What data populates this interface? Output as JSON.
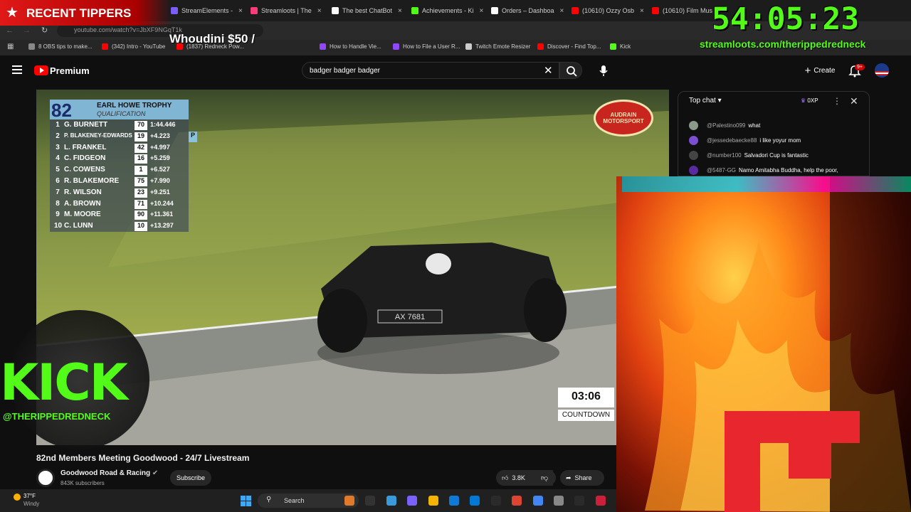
{
  "browser": {
    "tabs": [
      {
        "title": "StreamElements -",
        "color": "#7a5cff"
      },
      {
        "title": "Streamloots | The",
        "color": "#ff3c78"
      },
      {
        "title": "The best ChatBot",
        "color": "#ffffff"
      },
      {
        "title": "Achievements - Ki",
        "color": "#53fc18"
      },
      {
        "title": "Orders – Dashboa",
        "color": "#ffffff"
      },
      {
        "title": "(10610) Ozzy Osb",
        "color": "#ff0000"
      },
      {
        "title": "(10610) Film Mus",
        "color": "#ff0000"
      }
    ],
    "address": "youtube.com/watch?v=JbXF9NGqT1k",
    "bookmarks": [
      {
        "label": "8 OBS tips to make...",
        "color": "#888888"
      },
      {
        "label": "(342) Intro - YouTube",
        "color": "#ff0000"
      },
      {
        "label": "(1837) Redneck Pow...",
        "color": "#ff0000"
      },
      {
        "label": "How to Handle Vie...",
        "color": "#9146ff"
      },
      {
        "label": "How to File a User R...",
        "color": "#9146ff"
      },
      {
        "label": "Twitch Emote Resizer",
        "color": "#cccccc"
      },
      {
        "label": "Discover - Find Top...",
        "color": "#ff0000"
      },
      {
        "label": "Kick",
        "color": "#53fc18"
      }
    ]
  },
  "youtube": {
    "premium": "Premium",
    "search_value": "badger badger badger",
    "create_label": "Create",
    "bell_badge": "9+"
  },
  "video": {
    "leaderboard": {
      "number": "82",
      "title": "EARL HOWE TROPHY",
      "subtitle": "QUALIFICATION",
      "rows": [
        {
          "pos": "1",
          "name": "G. BURNETT",
          "car": "70",
          "gap": "1:44.446"
        },
        {
          "pos": "2",
          "name": "P. BLAKENEY-EDWARDS",
          "car": "19",
          "gap": "+4.223"
        },
        {
          "pos": "3",
          "name": "L. FRANKEL",
          "car": "42",
          "gap": "+4.997"
        },
        {
          "pos": "4",
          "name": "C. FIDGEON",
          "car": "16",
          "gap": "+5.259"
        },
        {
          "pos": "5",
          "name": "C. COWENS",
          "car": "1",
          "gap": "+6.527"
        },
        {
          "pos": "6",
          "name": "R. BLAKEMORE",
          "car": "75",
          "gap": "+7.990"
        },
        {
          "pos": "7",
          "name": "R. WILSON",
          "car": "23",
          "gap": "+9.251"
        },
        {
          "pos": "8",
          "name": "A. BROWN",
          "car": "71",
          "gap": "+10.244"
        },
        {
          "pos": "9",
          "name": "M. MOORE",
          "car": "90",
          "gap": "+11.361"
        },
        {
          "pos": "10",
          "name": "C. LUNN",
          "car": "10",
          "gap": "+13.297"
        }
      ],
      "pit_flag": "P"
    },
    "sponsor": "AUDRAIN MOTORSPORT",
    "plate": "AX 7681",
    "countdown_time": "03:06",
    "countdown_label": "COUNTDOWN",
    "title": "82nd Members Meeting Goodwood - 24/7 Livestream",
    "channel": "Goodwood Road & Racing",
    "subscribers": "843K subscribers",
    "subscribe_label": "Subscribe",
    "likes": "3.8K",
    "share_label": "Share"
  },
  "chat": {
    "title": "Top chat",
    "xp": "0XP",
    "messages": [
      {
        "author": "@Palestino099",
        "text": "what",
        "color": "#8a9a8a"
      },
      {
        "author": "@jessedebaecke88",
        "text": "i like yoyur mom",
        "color": "#7b4fd0"
      },
      {
        "author": "@number100",
        "text": "Salvadori Cup is fantastic",
        "color": "#444444"
      },
      {
        "author": "@5487-GG",
        "text": "Namo Amitabha Buddha, help the poor,",
        "color": "#5a2aa0"
      }
    ]
  },
  "overlay": {
    "recent_tippers": "RECENT TIPPERS",
    "tipper": "Whoudini $50 /",
    "timer": "54:05:23",
    "timer_url": "streamloots.com/therippedredneck",
    "kick": "KICK",
    "kick_handle": "@THERIPPEDREDNECK"
  },
  "taskbar": {
    "temp": "37°F",
    "weather": "Windy",
    "search": "Search",
    "icon_colors": [
      "#e07a2a",
      "#333",
      "#3a9bdc",
      "#7b61ff",
      "#f4b400",
      "#0f7ad6",
      "#0078d4",
      "#2a2a2a",
      "#dd4433",
      "#4285f4",
      "#888888",
      "#2a2a2a",
      "#cc1f3a"
    ]
  }
}
